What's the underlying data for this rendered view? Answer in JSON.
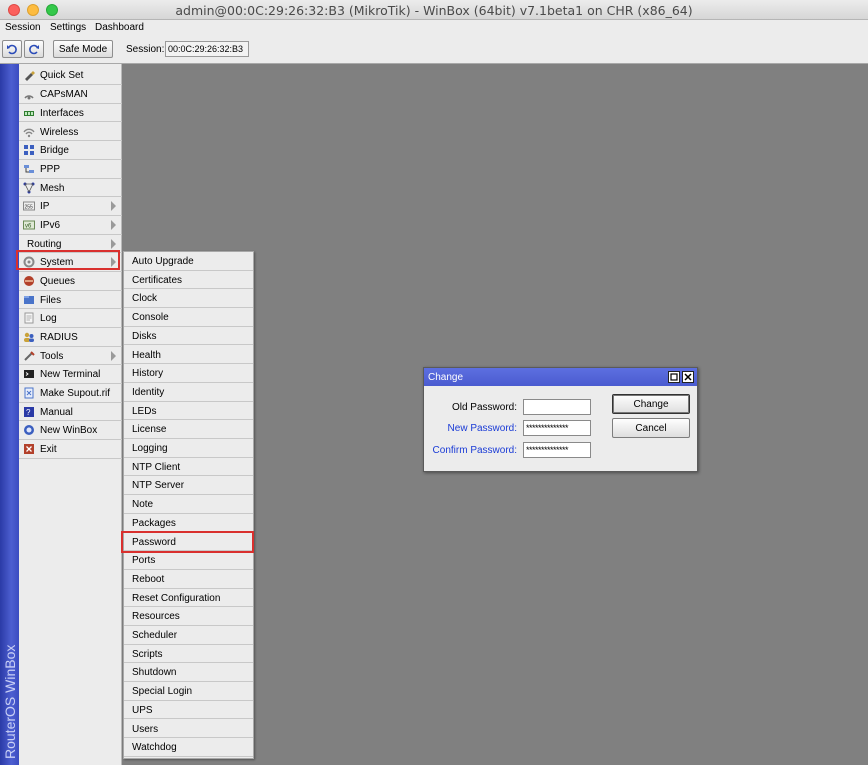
{
  "window": {
    "title": "admin@00:0C:29:26:32:B3 (MikroTik) - WinBox (64bit) v7.1beta1 on CHR (x86_64)"
  },
  "menubar": [
    "Session",
    "Settings",
    "Dashboard"
  ],
  "toolbar": {
    "safe_mode_label": "Safe Mode",
    "session_label": "Session:",
    "session_value": "00:0C:29:26:32:B3"
  },
  "brand": "RouterOS WinBox",
  "left_menu": [
    {
      "label": "Quick Set",
      "icon": "quick-set-icon",
      "submenu": false
    },
    {
      "label": "CAPsMAN",
      "icon": "capsman-icon",
      "submenu": false
    },
    {
      "label": "Interfaces",
      "icon": "interfaces-icon",
      "submenu": false
    },
    {
      "label": "Wireless",
      "icon": "wireless-icon",
      "submenu": false
    },
    {
      "label": "Bridge",
      "icon": "bridge-icon",
      "submenu": false
    },
    {
      "label": "PPP",
      "icon": "ppp-icon",
      "submenu": false
    },
    {
      "label": "Mesh",
      "icon": "mesh-icon",
      "submenu": false
    },
    {
      "label": "IP",
      "icon": "ip-icon",
      "submenu": true
    },
    {
      "label": "IPv6",
      "icon": "ipv6-icon",
      "submenu": true
    },
    {
      "label": "Routing",
      "icon": "",
      "submenu": true
    },
    {
      "label": "System",
      "icon": "system-icon",
      "submenu": true
    },
    {
      "label": "Queues",
      "icon": "queues-icon",
      "submenu": false
    },
    {
      "label": "Files",
      "icon": "files-icon",
      "submenu": false
    },
    {
      "label": "Log",
      "icon": "log-icon",
      "submenu": false
    },
    {
      "label": "RADIUS",
      "icon": "radius-icon",
      "submenu": false
    },
    {
      "label": "Tools",
      "icon": "tools-icon",
      "submenu": true
    },
    {
      "label": "New Terminal",
      "icon": "terminal-icon",
      "submenu": false
    },
    {
      "label": "Make Supout.rif",
      "icon": "supout-icon",
      "submenu": false
    },
    {
      "label": "Manual",
      "icon": "manual-icon",
      "submenu": false
    },
    {
      "label": "New WinBox",
      "icon": "winbox-icon",
      "submenu": false
    },
    {
      "label": "Exit",
      "icon": "exit-icon",
      "submenu": false
    }
  ],
  "system_submenu": [
    "Auto Upgrade",
    "Certificates",
    "Clock",
    "Console",
    "Disks",
    "Health",
    "History",
    "Identity",
    "LEDs",
    "License",
    "Logging",
    "NTP Client",
    "NTP Server",
    "Note",
    "Packages",
    "Password",
    "Ports",
    "Reboot",
    "Reset Configuration",
    "Resources",
    "Scheduler",
    "Scripts",
    "Shutdown",
    "Special Login",
    "UPS",
    "Users",
    "Watchdog"
  ],
  "dialog": {
    "title": "Change",
    "old_password_label": "Old Password:",
    "old_password_value": "",
    "new_password_label": "New Password:",
    "new_password_value": "**************",
    "confirm_password_label": "Confirm Password:",
    "confirm_password_value": "**************",
    "change_button": "Change",
    "cancel_button": "Cancel"
  },
  "colors": {
    "highlight": "#d9302e",
    "title_blue": "#4a5bd0",
    "link_blue": "#1a3bd6",
    "workspace": "#808080"
  }
}
